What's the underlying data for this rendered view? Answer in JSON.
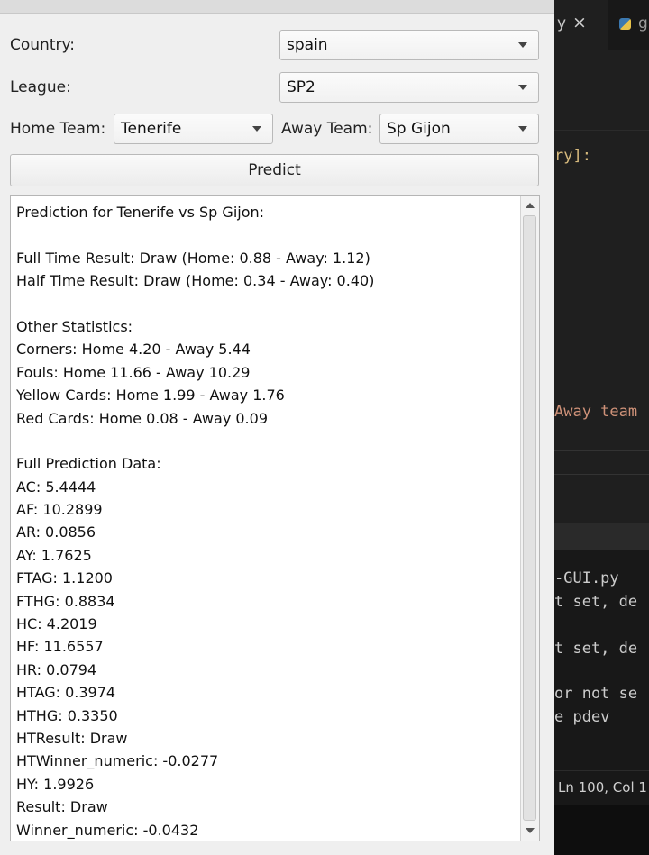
{
  "form": {
    "country_label": "Country:",
    "country_value": "spain",
    "league_label": "League:",
    "league_value": "SP2",
    "home_label": "Home Team:",
    "home_value": "Tenerife",
    "away_label": "Away Team:",
    "away_value": "Sp Gijon",
    "predict_label": "Predict"
  },
  "output_lines": [
    "Prediction for Tenerife vs Sp Gijon:",
    "",
    "Full Time Result: Draw (Home: 0.88 - Away: 1.12)",
    "Half Time Result: Draw (Home: 0.34 - Away: 0.40)",
    "",
    "Other Statistics:",
    "Corners: Home 4.20 - Away 5.44",
    "Fouls: Home 11.66 - Away 10.29",
    "Yellow Cards: Home 1.99 - Away 1.76",
    "Red Cards: Home 0.08 - Away 0.09",
    "",
    "Full Prediction Data:",
    "AC: 5.4444",
    "AF: 10.2899",
    "AR: 0.0856",
    "AY: 1.7625",
    "FTAG: 1.1200",
    "FTHG: 0.8834",
    "HC: 4.2019",
    "HF: 11.6557",
    "HR: 0.0794",
    "HTAG: 0.3974",
    "HTHG: 0.3350",
    "HTResult: Draw",
    "HTWinner_numeric: -0.0277",
    "HY: 1.9926",
    "Result: Draw",
    "Winner_numeric: -0.0432"
  ],
  "editor": {
    "tab1_title": "y",
    "tab1_close": "×",
    "tab2_title": "g",
    "code_top": "ry]:",
    "code_mid": "Away team",
    "term1": "-GUI.py",
    "term2": "t set, de",
    "term3": "t set, de",
    "term4": "or not se",
    "term5": "e pdev",
    "status": "Ln 100, Col 1"
  }
}
